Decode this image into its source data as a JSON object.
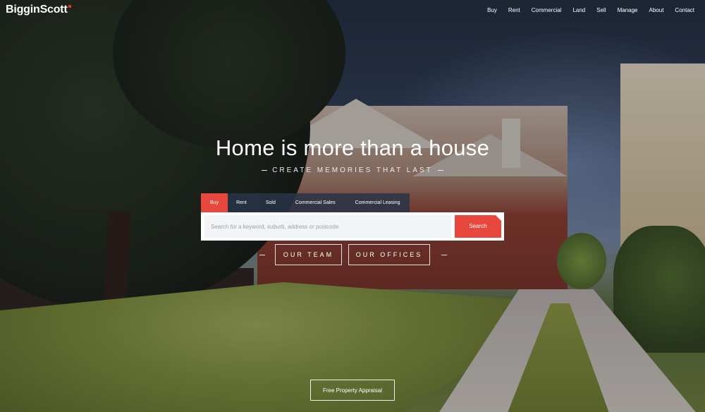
{
  "header": {
    "logo": "BigginScott",
    "nav": [
      "Buy",
      "Rent",
      "Commercial",
      "Land",
      "Sell",
      "Manage",
      "About",
      "Contact"
    ]
  },
  "hero": {
    "title": "Home is more than a house",
    "subtitle": "CREATE MEMORIES THAT LAST"
  },
  "search": {
    "tabs": [
      "Buy",
      "Rent",
      "Sold",
      "Commercial Sales",
      "Commercial Leasing"
    ],
    "active_tab": "Buy",
    "placeholder": "Search for a keyword, suburb, address or postcode",
    "button_label": "Search"
  },
  "actions": {
    "team_label": "OUR TEAM",
    "offices_label": "OUR OFFICES",
    "appraisal_label": "Free Property Appraisal"
  },
  "colors": {
    "accent": "#e7473c",
    "tab_bar": "#283448"
  }
}
